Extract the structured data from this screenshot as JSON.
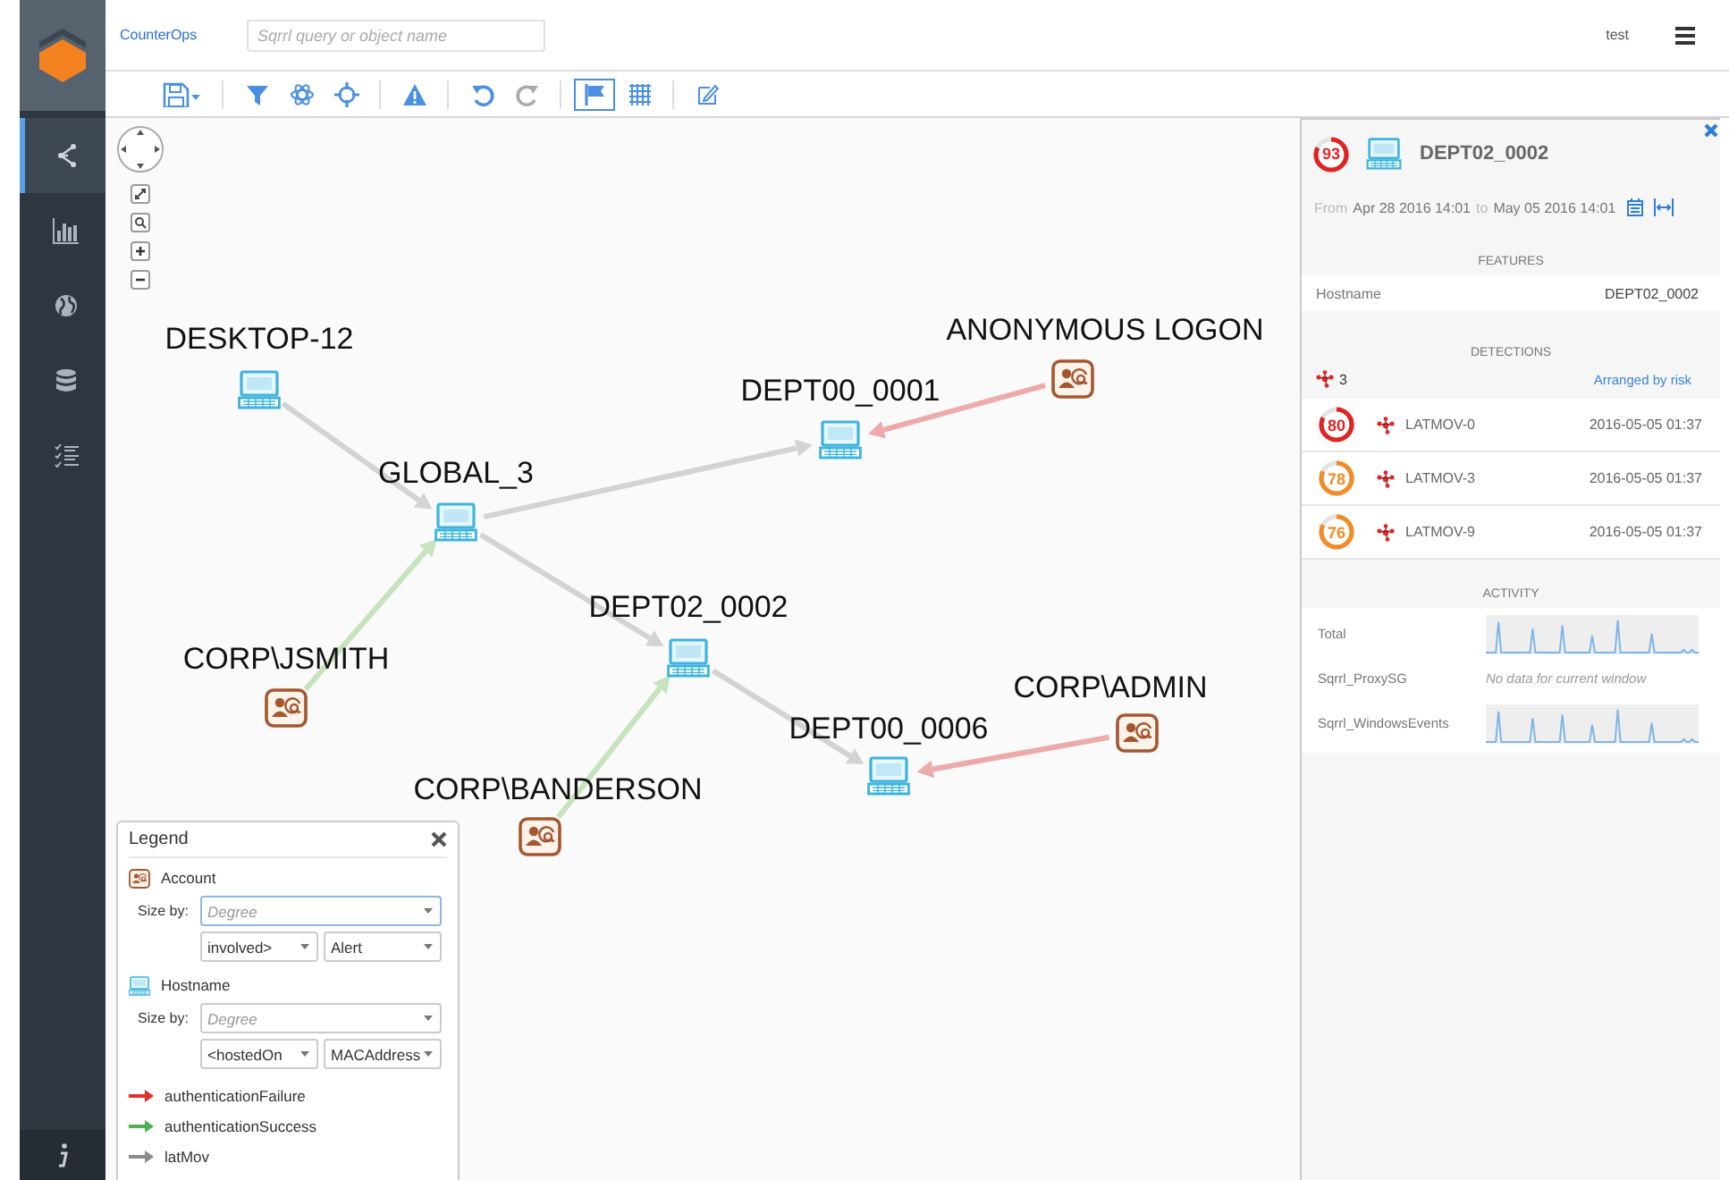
{
  "app": {
    "name": "CounterOps",
    "user": "test"
  },
  "search": {
    "placeholder": "Sqrrl query or object name"
  },
  "sidebar": {
    "items": [
      {
        "kind": "graph",
        "selected": true
      },
      {
        "kind": "chart",
        "selected": false
      },
      {
        "kind": "globe",
        "selected": false
      },
      {
        "kind": "database",
        "selected": false
      },
      {
        "kind": "list",
        "selected": false
      }
    ]
  },
  "toolbar_groups": [
    {
      "buttons": [
        {
          "kind": "save",
          "selected": false,
          "disabled": false
        }
      ]
    },
    {
      "buttons": [
        {
          "kind": "filter",
          "selected": false,
          "disabled": false
        },
        {
          "kind": "atom",
          "selected": false,
          "disabled": false
        },
        {
          "kind": "crosshair",
          "selected": false,
          "disabled": false
        }
      ]
    },
    {
      "buttons": [
        {
          "kind": "warning",
          "selected": false,
          "disabled": false
        }
      ]
    },
    {
      "buttons": [
        {
          "kind": "undo",
          "selected": false,
          "disabled": false
        },
        {
          "kind": "redo",
          "selected": false,
          "disabled": true
        }
      ]
    },
    {
      "buttons": [
        {
          "kind": "flag",
          "selected": true,
          "disabled": false
        },
        {
          "kind": "grid",
          "selected": false,
          "disabled": false
        }
      ]
    },
    {
      "buttons": [
        {
          "kind": "edit",
          "selected": false,
          "disabled": false
        }
      ]
    }
  ],
  "graph": {
    "nodes": [
      {
        "kind": "host",
        "label": "DESKTOP-12"
      },
      {
        "kind": "account",
        "label": "ANONYMOUS LOGON"
      },
      {
        "kind": "host",
        "label": "DEPT00_0001"
      },
      {
        "kind": "host",
        "label": "GLOBAL_3"
      },
      {
        "kind": "host",
        "label": "DEPT02_0002"
      },
      {
        "kind": "account",
        "label": "CORP\\JSMITH"
      },
      {
        "kind": "host",
        "label": "DEPT00_0006"
      },
      {
        "kind": "account",
        "label": "CORP\\ADMIN"
      },
      {
        "kind": "account",
        "label": "CORP\\BANDERSON"
      }
    ],
    "edges": [
      {
        "kind": "latMov"
      },
      {
        "kind": "latMov"
      },
      {
        "kind": "authenticationFailure"
      },
      {
        "kind": "latMov"
      },
      {
        "kind": "authenticationSuccess"
      },
      {
        "kind": "authenticationSuccess"
      },
      {
        "kind": "latMov"
      },
      {
        "kind": "authenticationFailure"
      }
    ]
  },
  "legend": {
    "title": "Legend",
    "sections": [
      {
        "kind": "account",
        "label": "Account",
        "size_by_label": "Size by:",
        "size_by": {
          "placeholder": "Degree",
          "focused": true
        },
        "selects": [
          {
            "value": "involved>"
          },
          {
            "value": "Alert"
          }
        ]
      },
      {
        "kind": "host",
        "label": "Hostname",
        "size_by_label": "Size by:",
        "size_by": {
          "placeholder": "Degree",
          "focused": false
        },
        "selects": [
          {
            "value": "<hostedOn"
          },
          {
            "value": "MACAddress"
          }
        ]
      }
    ],
    "edge_types": [
      {
        "label": "authenticationFailure",
        "color": "#e03131"
      },
      {
        "label": "authenticationSuccess",
        "color": "#4caf50"
      },
      {
        "label": "latMov",
        "color": "#8c8c8c"
      }
    ]
  },
  "details": {
    "score": "93",
    "color": "#e02424",
    "title": "DEPT02_0002",
    "range": {
      "from_label": "From",
      "start": "Apr 28 2016 14:01",
      "to_label": "to",
      "end": "May 05 2016 14:01"
    },
    "features": {
      "heading": "FEATURES",
      "rows": [
        {
          "name": "Hostname",
          "value": "DEPT02_0002"
        }
      ]
    },
    "detections": {
      "heading": "DETECTIONS",
      "count": "3",
      "sort_link": "Arranged by risk",
      "rows": [
        {
          "score": "80",
          "color": "#e02424",
          "name": "LATMOV-0",
          "time": "2016-05-05 01:37"
        },
        {
          "score": "78",
          "color": "#f28c28",
          "name": "LATMOV-3",
          "time": "2016-05-05 01:37"
        },
        {
          "score": "76",
          "color": "#f28c28",
          "name": "LATMOV-9",
          "time": "2016-05-05 01:37"
        }
      ]
    },
    "activity": {
      "heading": "ACTIVITY",
      "rows": [
        {
          "kind": "sparkline",
          "name": "Total"
        },
        {
          "kind": "message",
          "name": "Sqrrl_ProxySG",
          "message": "No data for current window"
        },
        {
          "kind": "sparkline",
          "name": "Sqrrl_WindowsEvents"
        }
      ]
    }
  }
}
